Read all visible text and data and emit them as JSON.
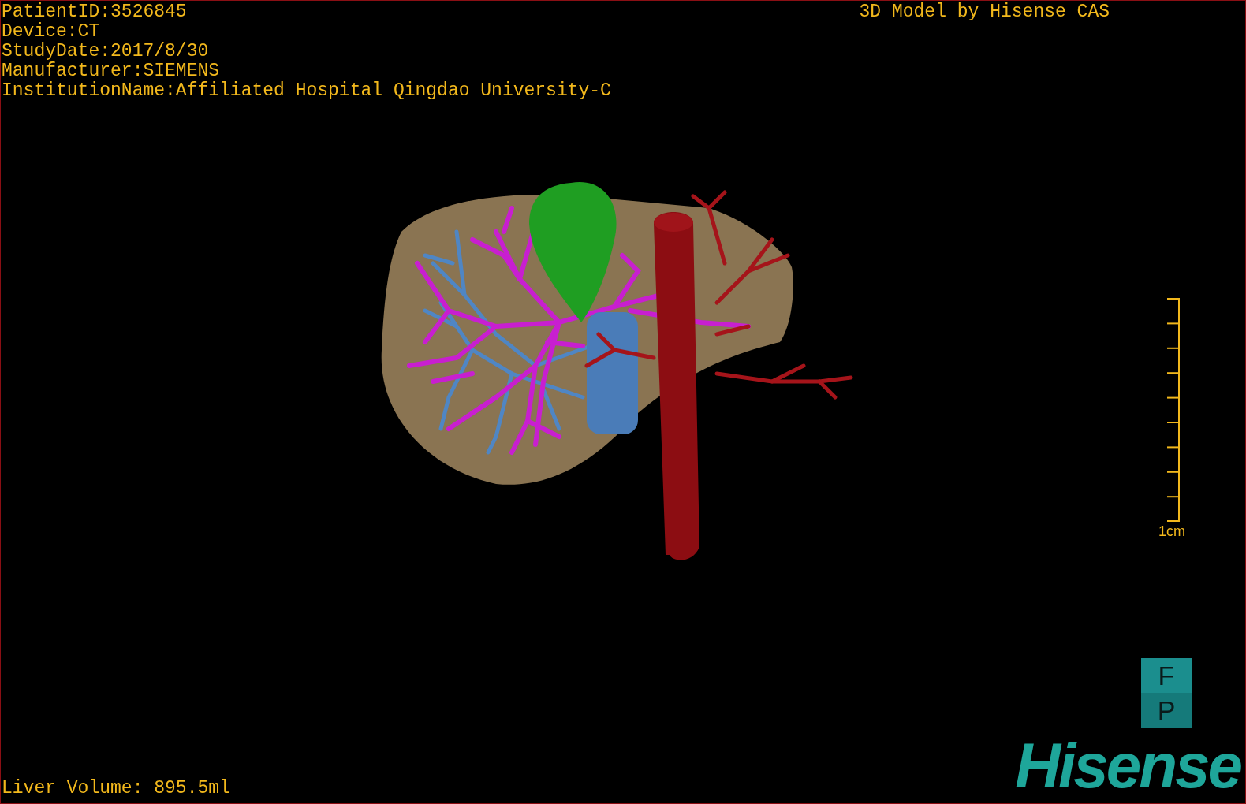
{
  "patient_info": [
    "PatientID:3526845",
    "Device:CT",
    "StudyDate:2017/8/30",
    "Manufacturer:SIEMENS",
    "InstitutionName:Affiliated Hospital Qingdao University-C"
  ],
  "title": "3D Model by Hisense CAS",
  "scale_bar": {
    "label": "1cm"
  },
  "liver_volume": "Liver Volume: 895.5ml",
  "orientation_cube": {
    "faces": [
      "F",
      "P"
    ]
  },
  "logo": "Hisense"
}
